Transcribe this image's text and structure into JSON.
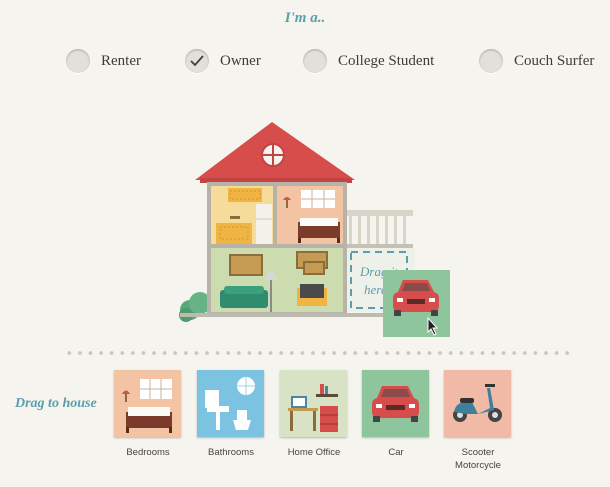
{
  "heading": "I'm a..",
  "roles": [
    {
      "label": "Renter",
      "checked": false
    },
    {
      "label": "Owner",
      "checked": true
    },
    {
      "label": "College Student",
      "checked": false
    },
    {
      "label": "Couch Surfer",
      "checked": false
    }
  ],
  "drop_zone": {
    "label": "Drag it here"
  },
  "tray": {
    "label": "Drag to house",
    "items": [
      {
        "name": "Bedrooms"
      },
      {
        "name": "Bathrooms"
      },
      {
        "name": "Home Office"
      },
      {
        "name": "Car"
      },
      {
        "name": "Scooter Motorcycle"
      }
    ]
  },
  "colors": {
    "accent": "#5a9eab",
    "roof": "#d64d4c",
    "bedroom_bg": "#f2c4a4",
    "bathroom_bg": "#7cc3e1",
    "office_bg": "#d8e2c4",
    "car_bg": "#8fc59c",
    "scooter_bg": "#f0baa6"
  }
}
